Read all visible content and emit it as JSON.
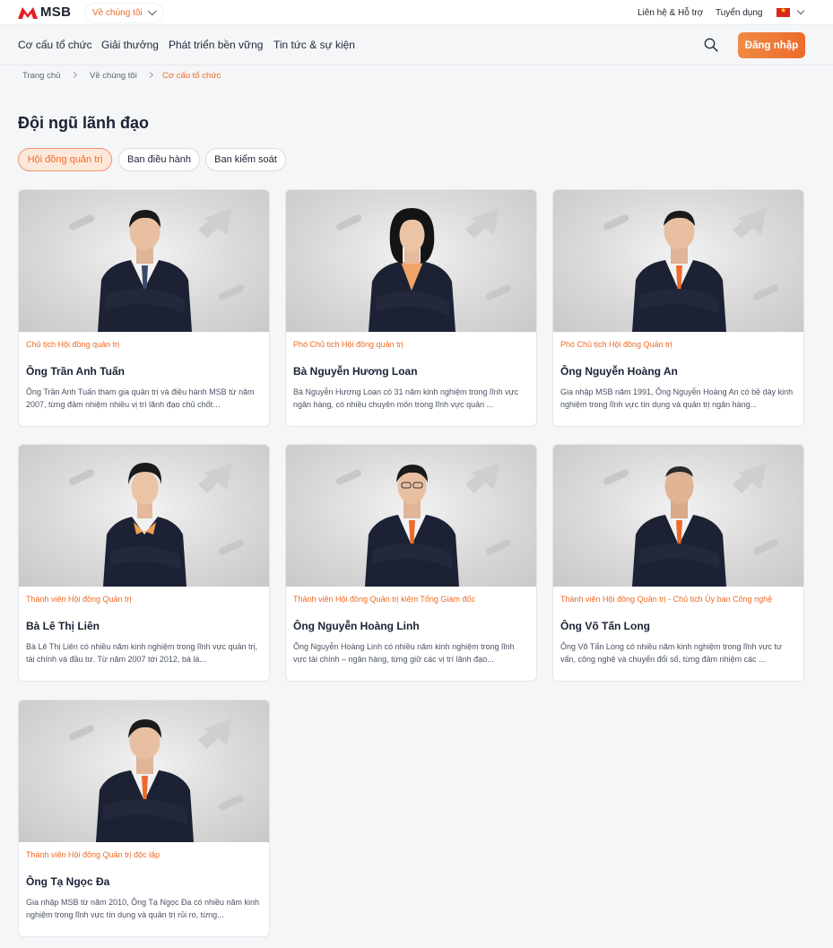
{
  "brand": {
    "name": "MSB",
    "accent": "#ef6a24"
  },
  "topbar": {
    "about_menu": "Về chúng tôi",
    "contact": "Liên hệ & Hỗ trợ",
    "careers": "Tuyển dụng",
    "language_icon": "vietnam-flag-icon"
  },
  "nav": {
    "items": [
      "Cơ cấu tổ chức",
      "Giải thưởng",
      "Phát triển bền vững",
      "Tin tức & sự kiện"
    ],
    "search_icon": "search-icon",
    "login": "Đăng nhập"
  },
  "breadcrumb": [
    "Trang chủ",
    "Về chúng tôi",
    "Cơ cấu tổ chức"
  ],
  "page_title": "Đội ngũ lãnh đạo",
  "tabs": [
    {
      "label": "Hội đồng quản trị",
      "active": true
    },
    {
      "label": "Ban điều hành",
      "active": false
    },
    {
      "label": "Ban kiểm soát",
      "active": false
    }
  ],
  "leaders": [
    {
      "role": "Chủ tịch Hội đồng quản trị",
      "name": "Ông Trần Anh Tuấn",
      "desc": "Ông Trần Anh Tuấn tham gia quản trị và điều hành MSB từ năm 2007, từng đảm nhiệm nhiều vị trí lãnh đạo chủ chốt…"
    },
    {
      "role": "Phó Chủ tịch Hội đồng quản trị",
      "name": "Bà Nguyễn Hương Loan",
      "desc": "Bà Nguyễn Hương Loan có 31 năm kinh nghiệm trong lĩnh vực ngân hàng, có nhiều chuyên môn trong lĩnh vực quản ..."
    },
    {
      "role": "Phó Chủ tịch Hội đồng Quản trị",
      "name": "Ông Nguyễn Hoàng An",
      "desc": "Gia nhập MSB năm 1991, Ông Nguyễn Hoàng An có bề dày kinh nghiệm trong lĩnh vực tín dụng và quản trị ngân hàng..."
    },
    {
      "role": "Thành viên Hội đồng Quản trị",
      "name": "Bà Lê Thị Liên",
      "desc": "Bà Lê Thị Liên có nhiều năm kinh nghiệm trong lĩnh vực quản trị, tài chính và đầu tư. Từ năm 2007 tới 2012, bà là..."
    },
    {
      "role": "Thành viên Hội đồng Quản trị kiêm Tổng Giám đốc",
      "name": "Ông Nguyễn Hoàng Linh",
      "desc": "Ông Nguyễn Hoàng Linh có nhiều năm kinh nghiệm trong lĩnh vực tài chính – ngân hàng, từng giữ các vị trí lãnh đạo..."
    },
    {
      "role": "Thành viên Hội đồng Quản trị - Chủ tịch Ủy ban Công nghệ",
      "name": "Ông Võ Tấn Long",
      "desc": "Ông Võ Tấn Long có nhiều năm kinh nghiệm trong lĩnh vực tư vấn, công nghệ và chuyển đổi số, từng đảm nhiệm các ..."
    },
    {
      "role": "Thành viên Hội đồng Quản trị độc lập",
      "name": "Ông Tạ Ngọc Đa",
      "desc": "Gia nhập MSB từ năm 2010, Ông Tạ Ngọc Đa có nhiều năm kinh nghiệm trong lĩnh vực tín dụng và quản trị rủi ro, từng..."
    }
  ]
}
